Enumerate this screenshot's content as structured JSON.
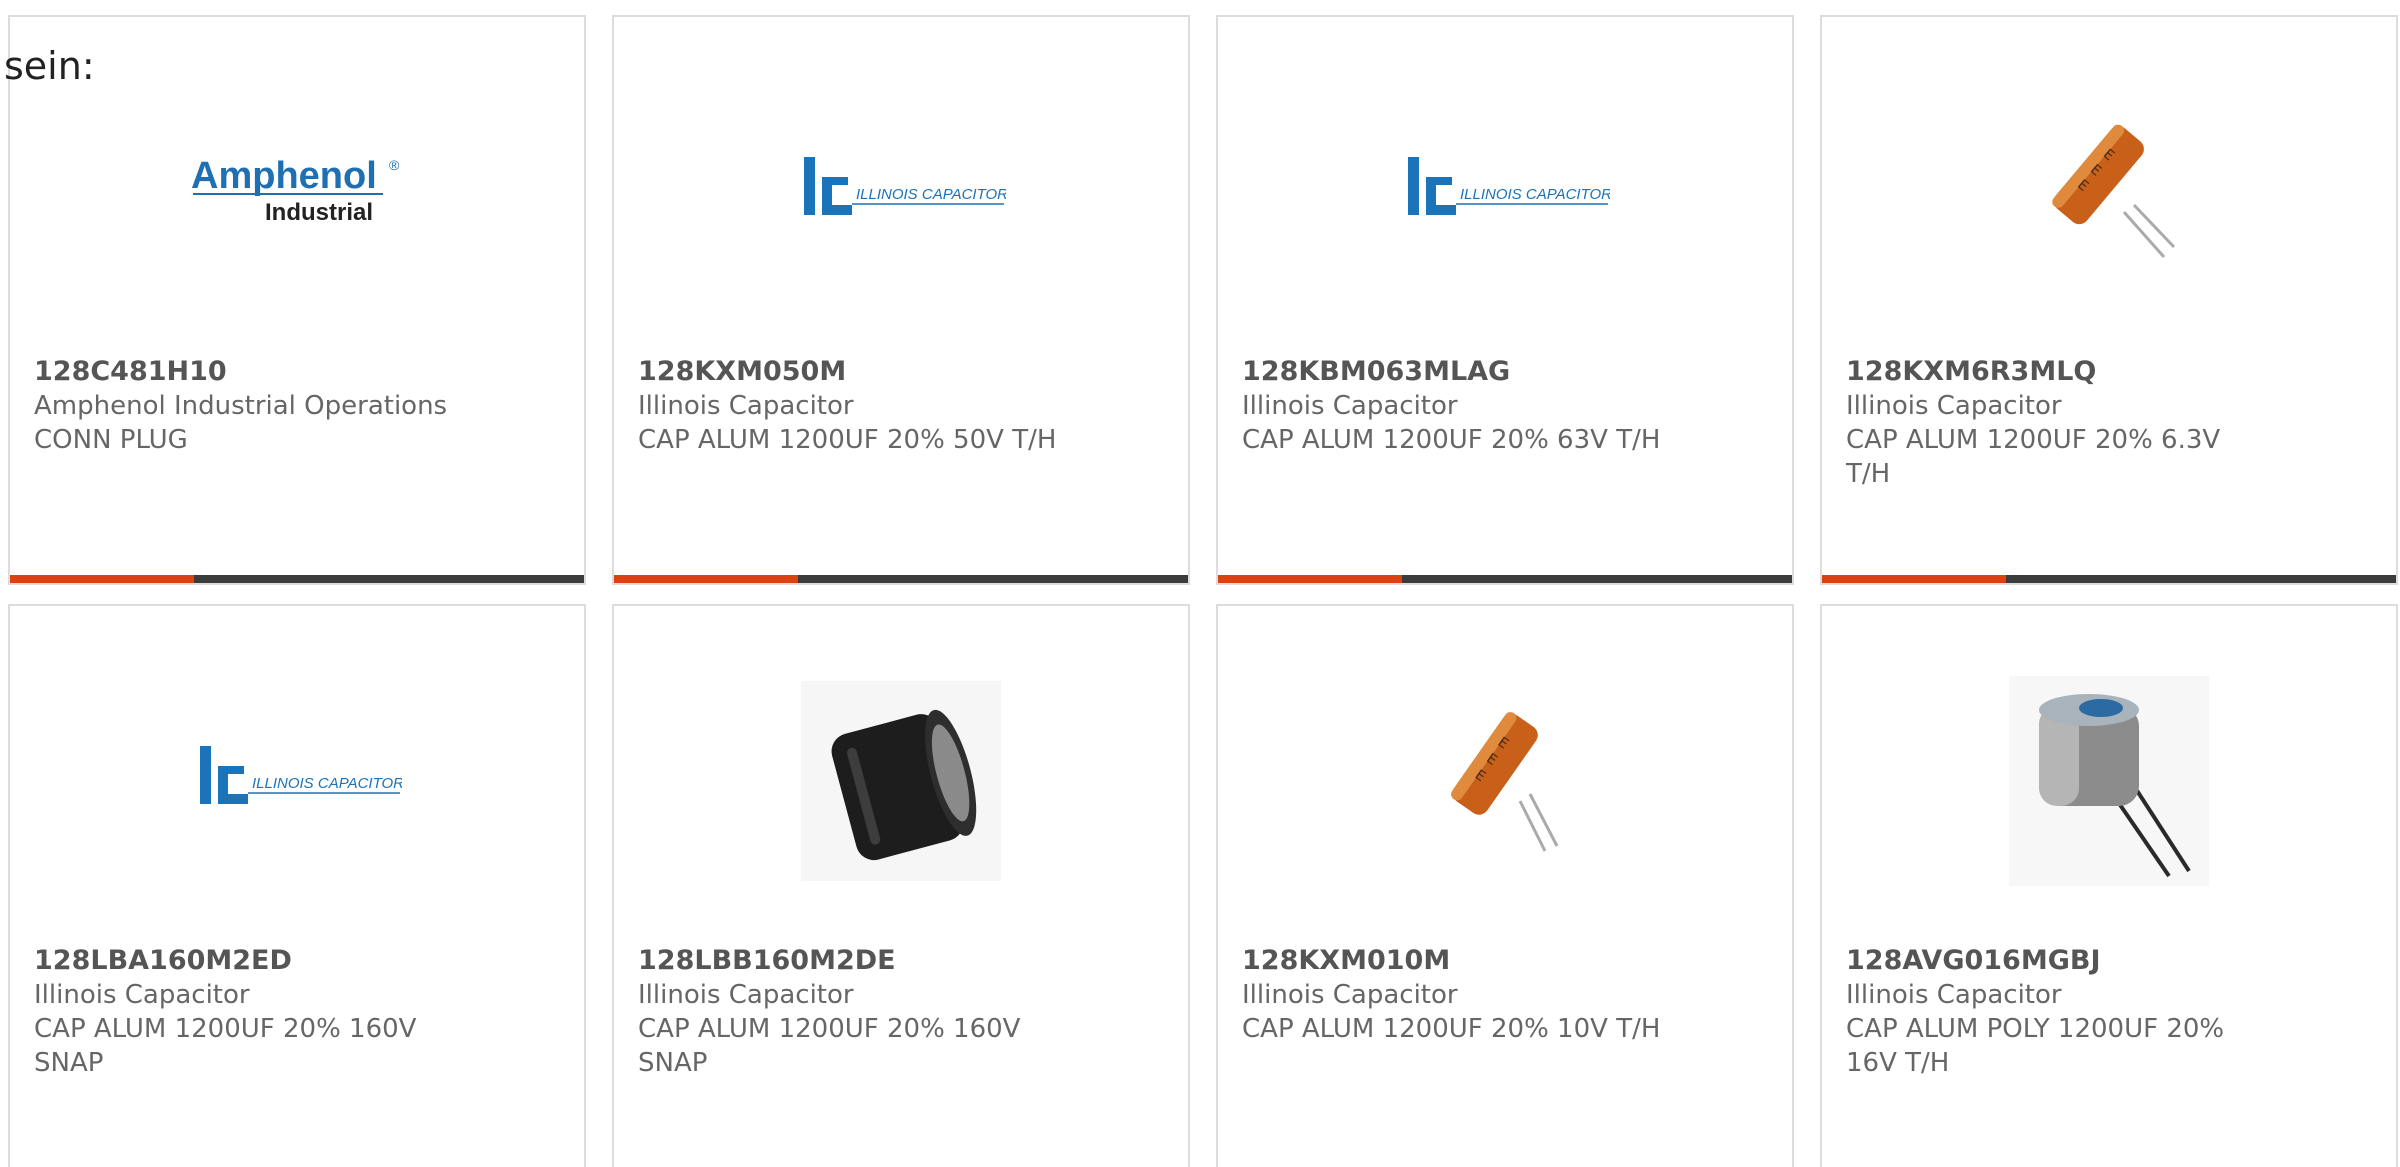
{
  "page": {
    "intro_text": "sein:"
  },
  "products": [
    {
      "part_number": "128C481H10",
      "manufacturer": "Amphenol Industrial Operations",
      "description": "CONN PLUG",
      "image": "amphenol-logo",
      "bar_fill": 0.32
    },
    {
      "part_number": "128KXM050M",
      "manufacturer": "Illinois Capacitor",
      "description": "CAP ALUM 1200UF 20% 50V T/H",
      "image": "illinois-capacitor-logo",
      "bar_fill": 0.32
    },
    {
      "part_number": "128KBM063MLAG",
      "manufacturer": "Illinois Capacitor",
      "description": "CAP ALUM 1200UF 20% 63V T/H",
      "image": "illinois-capacitor-logo",
      "bar_fill": 0.32
    },
    {
      "part_number": "128KXM6R3MLQ",
      "manufacturer": "Illinois Capacitor",
      "description": "CAP ALUM 1200UF 20% 6.3V T/H",
      "image": "orange-capacitor-photo",
      "bar_fill": 0.32
    },
    {
      "part_number": "128LBA160M2ED",
      "manufacturer": "Illinois Capacitor",
      "description": "CAP ALUM 1200UF 20% 160V SNAP",
      "image": "illinois-capacitor-logo"
    },
    {
      "part_number": "128LBB160M2DE",
      "manufacturer": "Illinois Capacitor",
      "description": "CAP ALUM 1200UF 20% 160V SNAP",
      "image": "black-snap-capacitor-photo"
    },
    {
      "part_number": "128KXM010M",
      "manufacturer": "Illinois Capacitor",
      "description": "CAP ALUM 1200UF 20% 10V T/H",
      "image": "orange-capacitor-photo"
    },
    {
      "part_number": "128AVG016MGBJ",
      "manufacturer": "Illinois Capacitor",
      "description": "CAP ALUM POLY 1200UF 20% 16V T/H",
      "image": "grey-polymer-capacitor-photo"
    }
  ],
  "logos": {
    "amphenol": {
      "brand": "Amphenol",
      "sub": "Industrial",
      "reg": "®"
    },
    "illinois": {
      "initials": "IC",
      "name": "ILLINOIS CAPACITOR, INC."
    }
  },
  "colors": {
    "accent": "#e0400d",
    "bar_dark": "#3b3b3b",
    "amphenol_blue": "#1f6fb3",
    "ic_blue": "#1b73b9"
  }
}
